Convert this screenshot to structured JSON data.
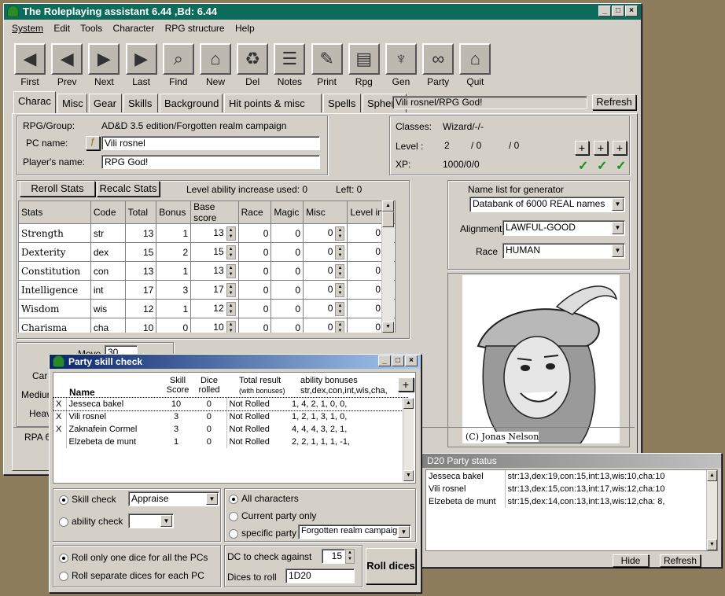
{
  "main": {
    "title": "The Roleplaying assistant 6.44 ,Bd: 6.44",
    "menu": [
      "System",
      "Edit",
      "Tools",
      "Character",
      "RPG structure",
      "Help"
    ],
    "toolbar": [
      {
        "label": "First",
        "icon": "arrow-first-icon",
        "glyph": "◀"
      },
      {
        "label": "Prev",
        "icon": "arrow-prev-icon",
        "glyph": "◀"
      },
      {
        "label": "Next",
        "icon": "arrow-next-icon",
        "glyph": "▶"
      },
      {
        "label": "Last",
        "icon": "arrow-last-icon",
        "glyph": "▶"
      },
      {
        "label": "Find",
        "icon": "glasses-icon",
        "glyph": "⌕"
      },
      {
        "label": "New",
        "icon": "map-icon",
        "glyph": "⌂"
      },
      {
        "label": "Del",
        "icon": "recycle-icon",
        "glyph": "♻"
      },
      {
        "label": "Notes",
        "icon": "notes-icon",
        "glyph": "☰"
      },
      {
        "label": "Print",
        "icon": "print-icon",
        "glyph": "✎"
      },
      {
        "label": "Rpg",
        "icon": "book-icon",
        "glyph": "▤"
      },
      {
        "label": "Gen",
        "icon": "gen-icon",
        "glyph": "♆"
      },
      {
        "label": "Party",
        "icon": "party-icon",
        "glyph": "∞"
      },
      {
        "label": "Quit",
        "icon": "house-icon",
        "glyph": "⌂"
      }
    ],
    "tabs": [
      "Charac",
      "Misc",
      "Gear",
      "Skills",
      "Background",
      "Hit points & misc",
      "Spells",
      "Spheres"
    ],
    "char_path": "Vili rosnel/RPG God!",
    "refresh": "Refresh"
  },
  "info": {
    "rpg_label": "RPG/Group:",
    "rpg_value": "AD&D 3.5 edition/Forgotten realm campaign",
    "pc_label": "PC name:",
    "pc_value": "Vili rosnel",
    "player_label": "Player's name:",
    "player_value": "RPG God!"
  },
  "classes": {
    "classes_label": "Classes:",
    "classes_value": "Wizard/-/-",
    "level_label": "Level :",
    "lv1": "2",
    "lv2": "/ 0",
    "lv3": "/ 0",
    "xp_label": "XP:",
    "xp_value": "1000/0/0",
    "plus": "+",
    "check": "✓"
  },
  "stats": {
    "reroll": "Reroll Stats",
    "recalc": "Recalc Stats",
    "level_inc": "Level ability increase used:  0",
    "left": "Left:  0",
    "headers": [
      "Stats",
      "Code",
      "Total",
      "Bonus",
      "Base score",
      "Race",
      "Magic",
      "Misc",
      "Level inc"
    ],
    "rows": [
      [
        "Strength",
        "str",
        "13",
        "1",
        "13",
        "0",
        "0",
        "0",
        "0"
      ],
      [
        "Dexterity",
        "dex",
        "15",
        "2",
        "15",
        "0",
        "0",
        "0",
        "0"
      ],
      [
        "Constitution",
        "con",
        "13",
        "1",
        "13",
        "0",
        "0",
        "0",
        "0"
      ],
      [
        "Intelligence",
        "int",
        "17",
        "3",
        "17",
        "0",
        "0",
        "0",
        "0"
      ],
      [
        "Wisdom",
        "wis",
        "12",
        "1",
        "12",
        "0",
        "0",
        "0",
        "0"
      ],
      [
        "Charisma",
        "cha",
        "10",
        "0",
        "10",
        "0",
        "0",
        "0",
        "0"
      ]
    ]
  },
  "gen": {
    "name_list_label": "Name list for generator",
    "name_list": "Databank of 6000 REAL names",
    "align_label": "Alignment",
    "align": "LAWFUL-GOOD",
    "race_label": "Race",
    "race": "HUMAN",
    "portrait_credit": "(C) Jonas Nelson"
  },
  "behind": {
    "move": "Move",
    "move_val": "30",
    "car": "Car",
    "medium": "Medium",
    "heavy": "Heav",
    "rpa": "RPA 6"
  },
  "party": {
    "title": "Party skill check",
    "hdr_name": "Name",
    "hdr_skill": "Skill Score",
    "hdr_dice": "Dice rolled",
    "hdr_total": "Total result",
    "hdr_total2": "(with bonuses)",
    "hdr_ab": "ability bonuses",
    "hdr_ab2": "str,dex,con,int,wis,cha,",
    "plus": "+",
    "rows": [
      [
        "X",
        "Jesseca bakel",
        "10",
        "0",
        "Not Rolled",
        "1,  4,  2,  1,  0,  0,"
      ],
      [
        "X",
        "Vili rosnel",
        "3",
        "0",
        "Not Rolled",
        "1,  2,  1,  3,  1,  0,"
      ],
      [
        "X",
        "Zaknafein Cormel",
        "3",
        "0",
        "Not Rolled",
        "4,  4,  4,  3,  2,  1,"
      ],
      [
        "",
        "Elzebeta de munt",
        "1",
        "0",
        "Not Rolled",
        "2,  2,  1,  1,  1,  -1,"
      ]
    ],
    "skill_check": "Skill check",
    "skill_val": "Appraise",
    "ability_check": "ability check",
    "ability_val": "",
    "all_chars": "All characters",
    "current_party": "Current party only",
    "specific_party": "specific party",
    "party_val": "Forgotten realm campaign",
    "roll_one": "Roll only one dice for all the PCs",
    "roll_sep": "Roll separate dices for each PC",
    "dc_label": "DC to check against",
    "dc_val": "15",
    "dices_label": "Dices to roll",
    "dices_val": "1D20",
    "roll_btn": "Roll dices"
  },
  "d20": {
    "title": "D20 Party status",
    "rows": [
      [
        "Jesseca bakel",
        "str:13,dex:19,con:15,int:13,wis:10,cha:10"
      ],
      [
        "Vili rosnel",
        "str:13,dex:15,con:13,int:17,wis:12,cha:10"
      ],
      [
        "Elzebeta de munt",
        "str:15,dex:14,con:13,int:13,wis:12,cha: 8,"
      ]
    ],
    "hide": "Hide",
    "refresh": "Refresh"
  }
}
